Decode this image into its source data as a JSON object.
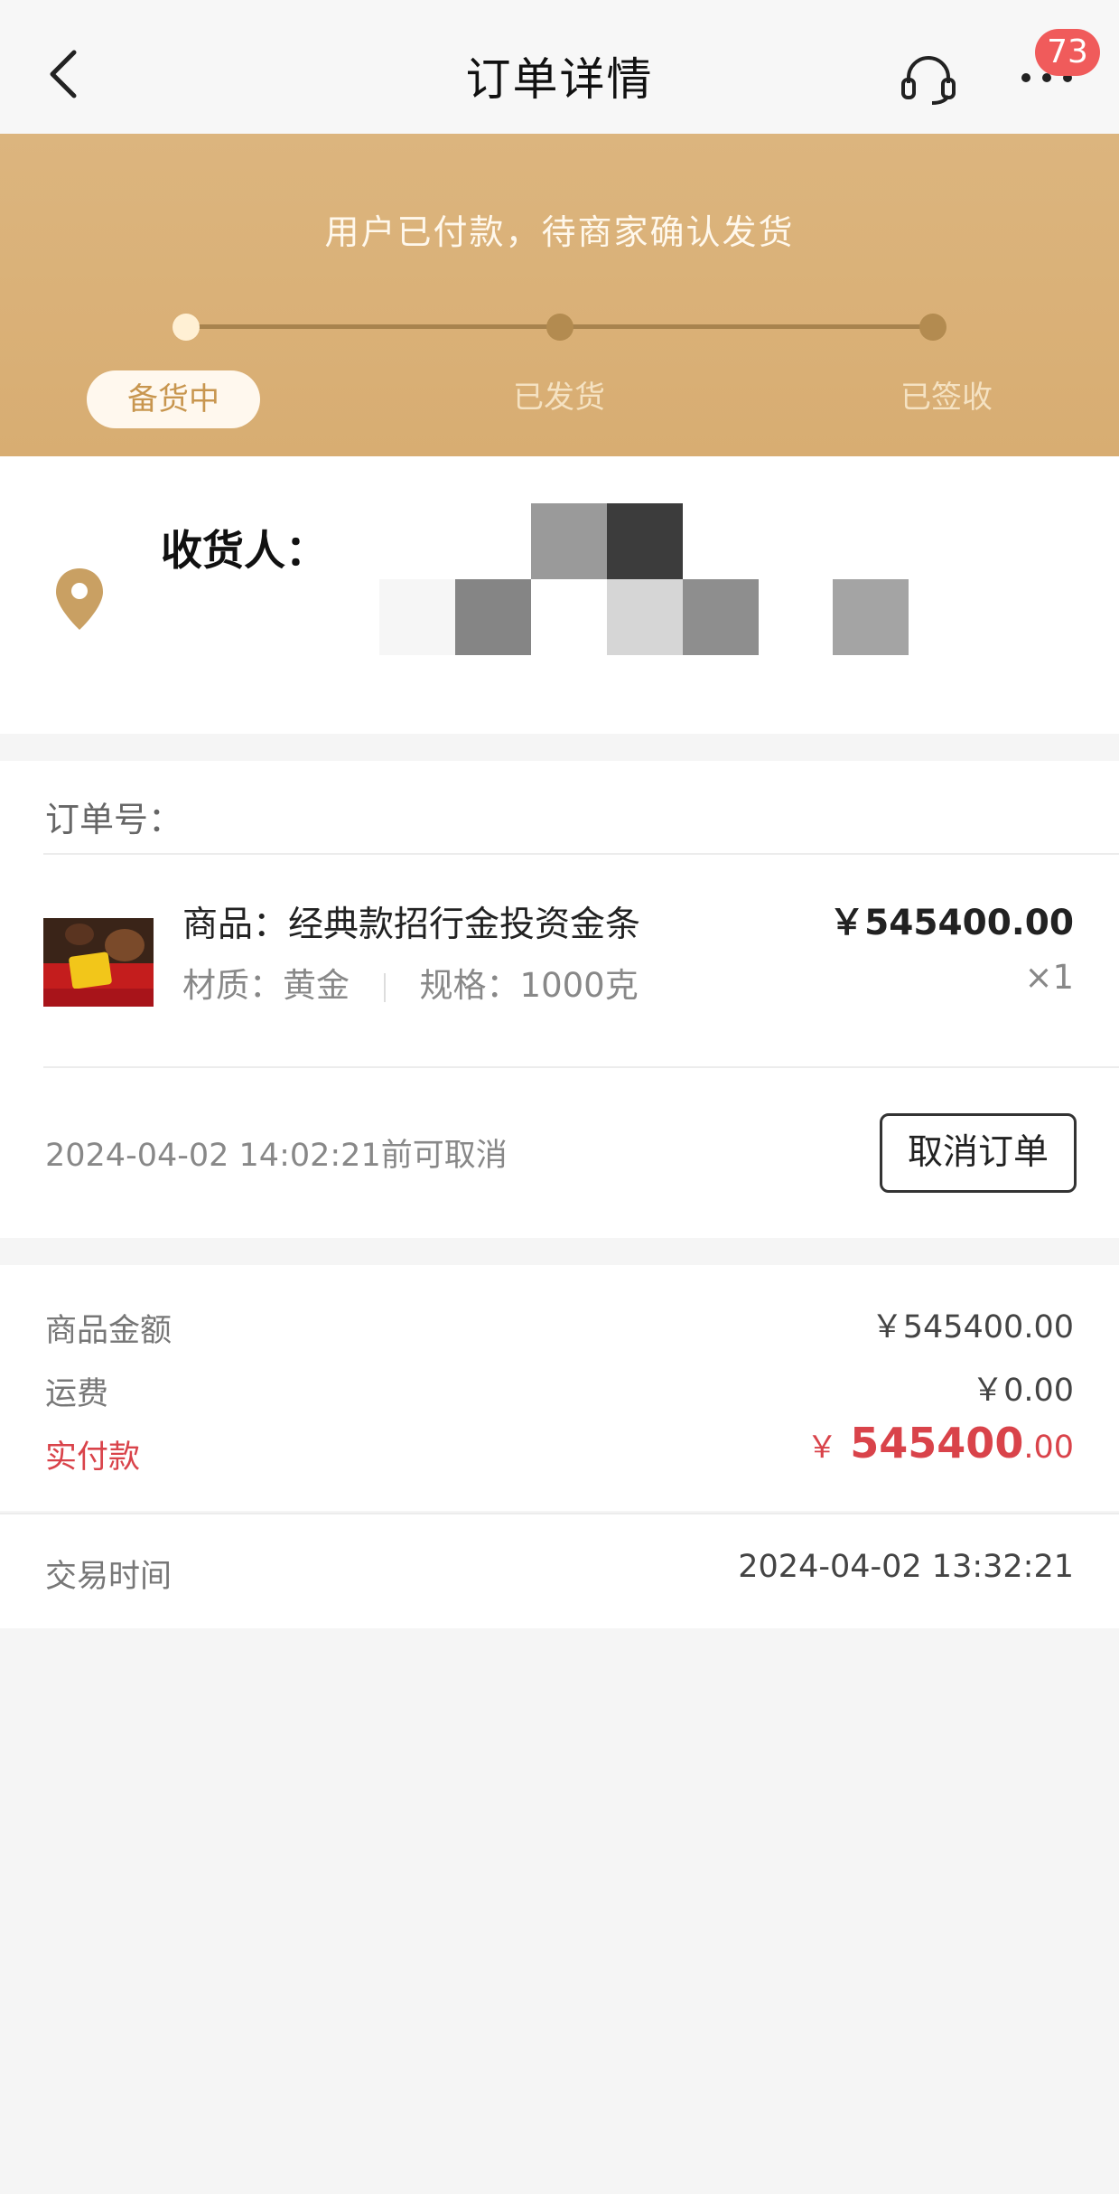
{
  "nav": {
    "title": "订单详情",
    "badge_count": "73",
    "icons": [
      "back-icon",
      "headset-icon",
      "more-icon"
    ]
  },
  "status": {
    "message": "用户已付款，待商家确认发货",
    "steps": [
      "备货中",
      "已发货",
      "已签收"
    ],
    "current_step": 0
  },
  "address": {
    "recipient_label": "收货人："
  },
  "order": {
    "order_no_label": "订单号：",
    "product_name": "商品：经典款招行金投资金条",
    "spec_material": "材质：黄金",
    "spec_size": "规格：1000克",
    "price": "￥545400.00",
    "quantity": "×1",
    "cancel_deadline": "2024-04-02 14:02:21前可取消",
    "cancel_button": "取消订单"
  },
  "totals": {
    "goods_amount_label": "商品金额",
    "goods_amount": "￥545400.00",
    "shipping_label": "运费",
    "shipping": "￥0.00",
    "paid_label": "实付款",
    "paid_symbol": "￥",
    "paid_integer": "545400",
    "paid_cents": ".00"
  },
  "trade": {
    "time_label": "交易时间",
    "time_value": "2024-04-02 13:32:21"
  },
  "colors": {
    "banner": "#d8ad72",
    "accent_red": "#d9434a",
    "badge": "#f05b5b",
    "pin": "#c9a063"
  }
}
